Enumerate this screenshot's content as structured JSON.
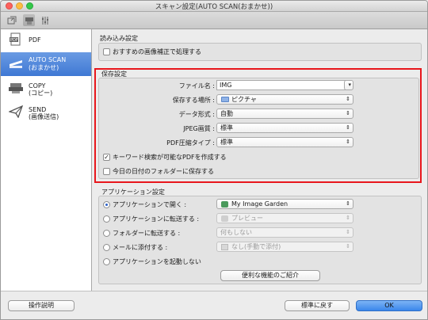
{
  "window": {
    "title": "スキャン設定(AUTO SCAN(おまかせ))"
  },
  "toolbar": {
    "icons": [
      "scan-from-computer-icon",
      "scan-from-panel-icon",
      "general-settings-icon"
    ]
  },
  "sidebar": {
    "items": [
      {
        "label1": "PDF",
        "label2": "",
        "icon": "pdf-icon"
      },
      {
        "label1": "AUTO SCAN",
        "label2": "(おまかせ)",
        "icon": "scanner-icon"
      },
      {
        "label1": "COPY",
        "label2": "(コピー)",
        "icon": "copy-icon"
      },
      {
        "label1": "SEND",
        "label2": "(画像送信)",
        "icon": "send-icon"
      }
    ]
  },
  "read_settings": {
    "title": "読み込み設定",
    "recommended_correction": "おすすめの画像補正で処理する"
  },
  "save_settings": {
    "title": "保存設定",
    "file_name_label": "ファイル名 :",
    "file_name_value": "IMG",
    "save_location_label": "保存する場所 :",
    "save_location_value": "ピクチャ",
    "data_format_label": "データ形式 :",
    "data_format_value": "自動",
    "jpeg_quality_label": "JPEG画質 :",
    "jpeg_quality_value": "標準",
    "pdf_compression_label": "PDF圧縮タイプ :",
    "pdf_compression_value": "標準",
    "keyword_pdf": "キーワード検索が可能なPDFを作成する",
    "date_folder": "今日の日付のフォルダーに保存する"
  },
  "app_settings": {
    "title": "アプリケーション設定",
    "open_with_label": "アプリケーションで開く :",
    "open_with_value": "My Image Garden",
    "transfer_app_label": "アプリケーションに転送する :",
    "transfer_app_value": "プレビュー",
    "transfer_folder_label": "フォルダーに転送する :",
    "transfer_folder_value": "何もしない",
    "attach_mail_label": "メールに添付する :",
    "attach_mail_value": "なし(手動で添付)",
    "no_launch_label": "アプリケーションを起動しない",
    "features_button": "便利な機能のご紹介"
  },
  "footer": {
    "instructions": "操作説明",
    "defaults": "標準に戻す",
    "ok": "OK"
  },
  "colors": {
    "selection": "#3f78d4",
    "highlight_border": "#e8161c",
    "ok_button": "#3a86eb"
  }
}
